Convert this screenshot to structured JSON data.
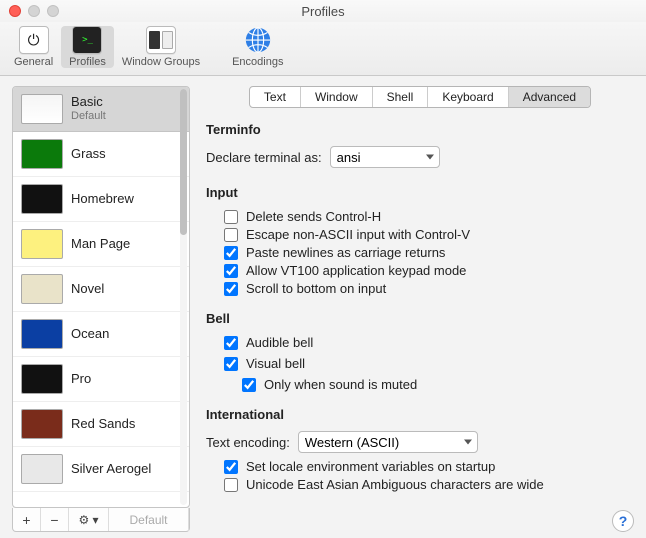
{
  "window": {
    "title": "Profiles"
  },
  "toolbar": {
    "general": "General",
    "profiles": "Profiles",
    "window_groups": "Window Groups",
    "encodings": "Encodings"
  },
  "sidebar": {
    "items": [
      {
        "name": "Basic",
        "sub": "Default",
        "cls": "basic",
        "selected": true
      },
      {
        "name": "Grass",
        "sub": "",
        "cls": "grass"
      },
      {
        "name": "Homebrew",
        "sub": "",
        "cls": "homebrew"
      },
      {
        "name": "Man Page",
        "sub": "",
        "cls": "manpage"
      },
      {
        "name": "Novel",
        "sub": "",
        "cls": "novel"
      },
      {
        "name": "Ocean",
        "sub": "",
        "cls": "ocean"
      },
      {
        "name": "Pro",
        "sub": "",
        "cls": "pro"
      },
      {
        "name": "Red Sands",
        "sub": "",
        "cls": "redsands"
      },
      {
        "name": "Silver Aerogel",
        "sub": "",
        "cls": "silver"
      }
    ],
    "footer": {
      "add": "+",
      "remove": "−",
      "gear": "⚙ ▾",
      "default": "Default"
    }
  },
  "tabs": {
    "labels": [
      "Text",
      "Window",
      "Shell",
      "Keyboard",
      "Advanced"
    ],
    "active": 4
  },
  "sections": {
    "terminfo": {
      "title": "Terminfo",
      "declare_label": "Declare terminal as:",
      "declare_value": "ansi"
    },
    "input": {
      "title": "Input",
      "opts": [
        {
          "label": "Delete sends Control-H",
          "checked": false
        },
        {
          "label": "Escape non-ASCII input with Control-V",
          "checked": false
        },
        {
          "label": "Paste newlines as carriage returns",
          "checked": true
        },
        {
          "label": "Allow VT100 application keypad mode",
          "checked": true
        },
        {
          "label": "Scroll to bottom on input",
          "checked": true
        }
      ]
    },
    "bell": {
      "title": "Bell",
      "audible": {
        "label": "Audible bell",
        "checked": true
      },
      "visual": {
        "label": "Visual bell",
        "checked": true
      },
      "only_muted": {
        "label": "Only when sound is muted",
        "checked": true
      }
    },
    "intl": {
      "title": "International",
      "encoding_label": "Text encoding:",
      "encoding_value": "Western (ASCII)",
      "opts": [
        {
          "label": "Set locale environment variables on startup",
          "checked": true
        },
        {
          "label": "Unicode East Asian Ambiguous characters are wide",
          "checked": false
        }
      ]
    }
  },
  "help": "?"
}
